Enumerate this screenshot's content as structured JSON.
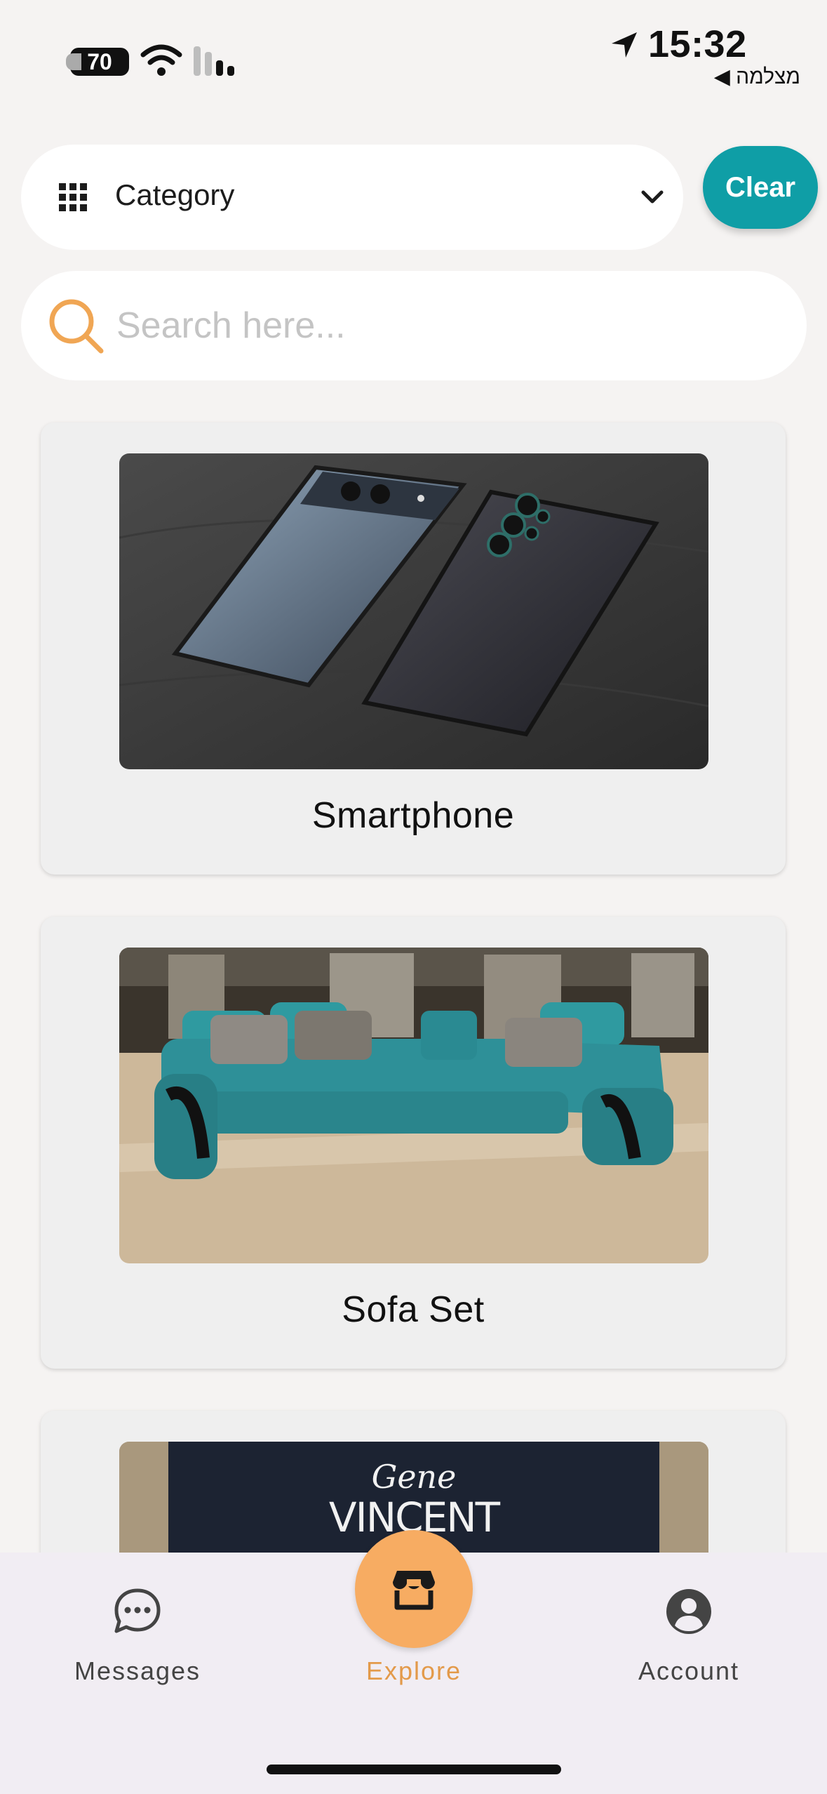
{
  "status_bar": {
    "battery": "70",
    "time": "15:32",
    "back_app": "מצלמה ◀"
  },
  "filters": {
    "category_label": "Category",
    "clear_label": "Clear",
    "search_placeholder": "Search here..."
  },
  "listings": [
    {
      "title": "Smartphone"
    },
    {
      "title": "Sofa Set"
    },
    {
      "title": ""
    }
  ],
  "tshirt_print": {
    "line1": "Gene",
    "line2": "VINCENT"
  },
  "bottom_nav": {
    "items": [
      {
        "label": "Messages",
        "icon": "chat-bubble-icon"
      },
      {
        "label": "Explore",
        "icon": "storefront-icon",
        "active": true
      },
      {
        "label": "Account",
        "icon": "account-circle-icon"
      }
    ]
  },
  "colors": {
    "accent_teal": "#0f9ea6",
    "accent_orange": "#f7ac62",
    "background": "#f5f3f2"
  }
}
